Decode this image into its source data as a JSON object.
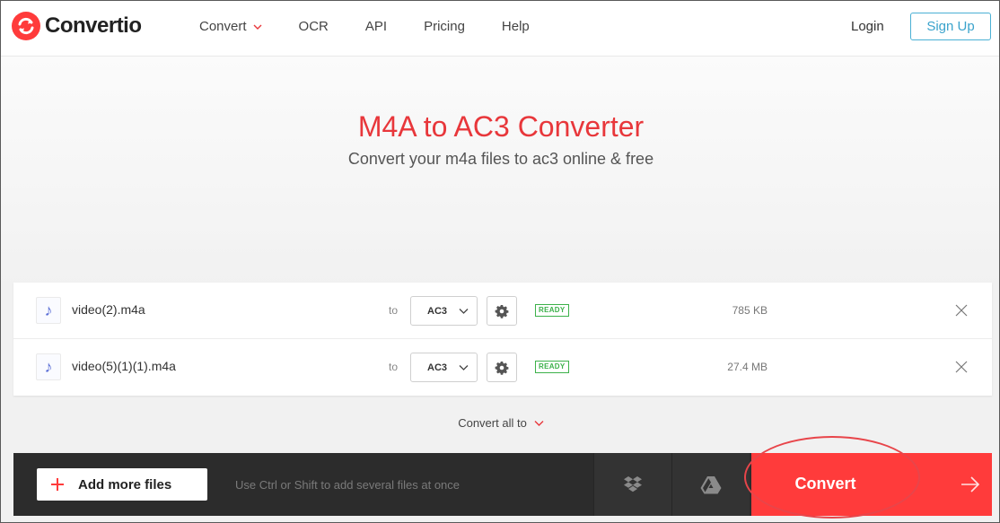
{
  "header": {
    "logo_text": "Convertio",
    "nav": [
      {
        "label": "Convert",
        "has_dropdown": true
      },
      {
        "label": "OCR"
      },
      {
        "label": "API"
      },
      {
        "label": "Pricing"
      },
      {
        "label": "Help"
      }
    ],
    "login_label": "Login",
    "signup_label": "Sign Up"
  },
  "hero": {
    "title": "M4A to AC3 Converter",
    "subtitle": "Convert your m4a files to ac3 online & free"
  },
  "files": [
    {
      "name": "video(2).m4a",
      "to_label": "to",
      "format": "AC3",
      "status": "READY",
      "size": "785 KB",
      "icon": "music-note-icon"
    },
    {
      "name": "video(5)(1)(1).m4a",
      "to_label": "to",
      "format": "AC3",
      "status": "READY",
      "size": "27.4 MB",
      "icon": "music-note-icon"
    }
  ],
  "convert_all_label": "Convert all to",
  "bottom_bar": {
    "add_files_label": "Add more files",
    "hint": "Use Ctrl or Shift to add several files at once",
    "convert_label": "Convert"
  },
  "colors": {
    "brand_red": "#ff3b3b",
    "title_red": "#e8373b",
    "ready_green": "#3cb14a",
    "signup_blue": "#3aa3cc",
    "bar_dark": "#2c2c2c"
  }
}
